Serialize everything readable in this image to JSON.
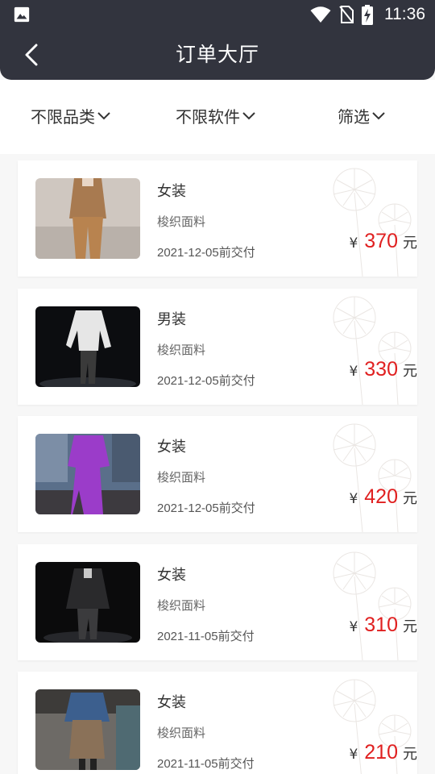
{
  "status_bar": {
    "time": "11:36",
    "icons": [
      "image-icon",
      "wifi-icon",
      "no-sim-icon",
      "battery-charging-icon"
    ]
  },
  "header": {
    "title": "订单大厅",
    "back_icon": "chevron-left-icon"
  },
  "filters": [
    {
      "label": "不限品类"
    },
    {
      "label": "不限软件"
    },
    {
      "label": "筛选"
    }
  ],
  "orders": [
    {
      "category": "女装",
      "fabric": "梭织面料",
      "due": "2021-12-05前交付",
      "currency": "¥",
      "price": "370",
      "unit": "元"
    },
    {
      "category": "男装",
      "fabric": "梭织面料",
      "due": "2021-12-05前交付",
      "currency": "¥",
      "price": "330",
      "unit": "元"
    },
    {
      "category": "女装",
      "fabric": "梭织面料",
      "due": "2021-12-05前交付",
      "currency": "¥",
      "price": "420",
      "unit": "元"
    },
    {
      "category": "女装",
      "fabric": "梭织面料",
      "due": "2021-11-05前交付",
      "currency": "¥",
      "price": "310",
      "unit": "元"
    },
    {
      "category": "女装",
      "fabric": "梭织面料",
      "due": "2021-11-05前交付",
      "currency": "¥",
      "price": "210",
      "unit": "元"
    }
  ],
  "colors": {
    "header_bg": "#32343e",
    "price": "#e02020",
    "page_bg": "#f7f7f7"
  }
}
